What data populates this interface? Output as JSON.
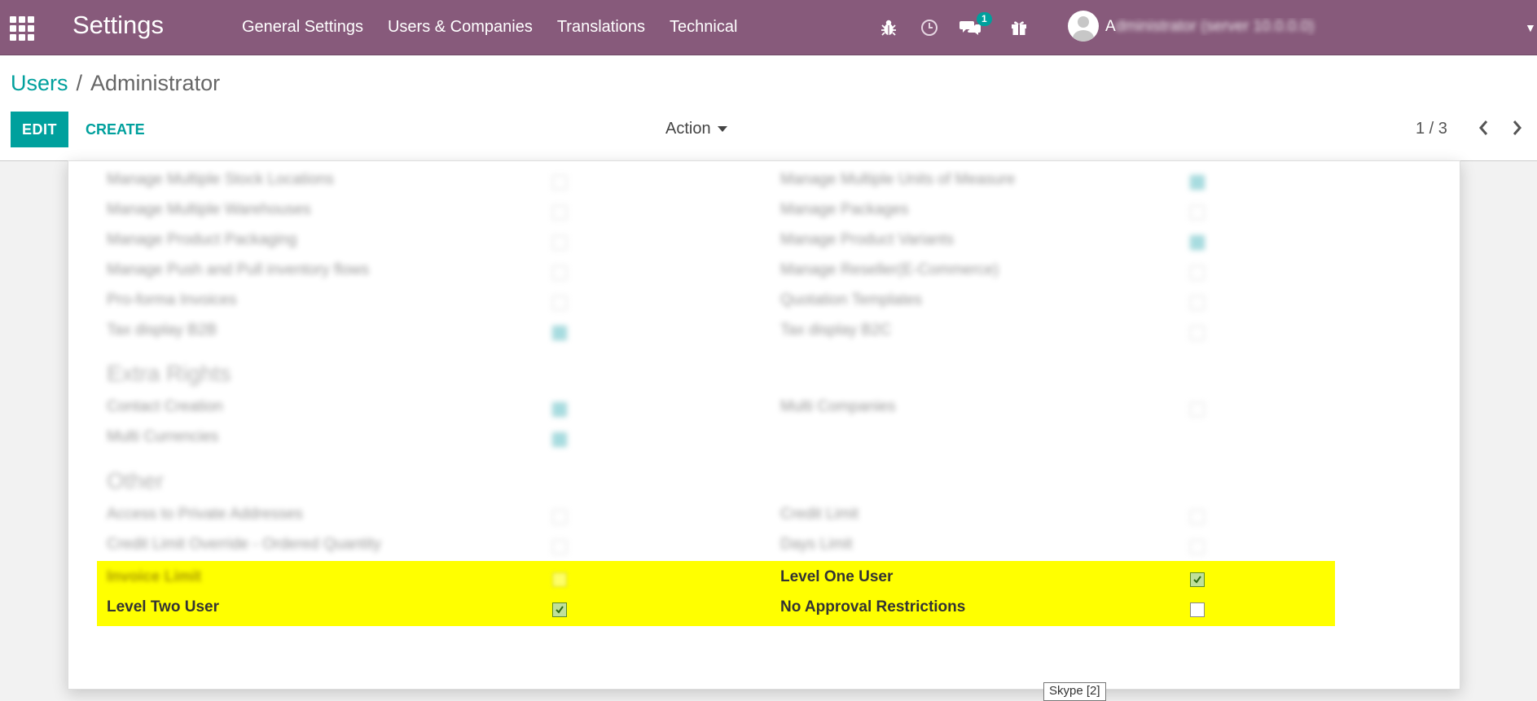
{
  "navbar": {
    "app_title": "Settings",
    "menu": [
      "General Settings",
      "Users & Companies",
      "Translations",
      "Technical"
    ],
    "chat_badge": "1",
    "user_initial": "A",
    "user_rest": "dministrator (server 10.0.0.0)",
    "accent": "#875a7b"
  },
  "breadcrumb": {
    "parent": "Users",
    "separator": "/",
    "current": "Administrator"
  },
  "buttons": {
    "edit": "EDIT",
    "create": "CREATE",
    "action": "Action"
  },
  "pager": {
    "value": "1 / 3"
  },
  "blurred_rights": {
    "rows_left": [
      {
        "label": "Manage Multiple Stock Locations",
        "checked": false
      },
      {
        "label": "Manage Multiple Warehouses",
        "checked": false
      },
      {
        "label": "Manage Product Packaging",
        "checked": false
      },
      {
        "label": "Manage Push and Pull inventory flows",
        "checked": false
      },
      {
        "label": "Pro-forma Invoices",
        "checked": false
      },
      {
        "label": "Tax display B2B",
        "checked": true
      }
    ],
    "rows_right": [
      {
        "label": "Manage Multiple Units of Measure",
        "checked": true
      },
      {
        "label": "Manage Packages",
        "checked": false
      },
      {
        "label": "Manage Product Variants",
        "checked": true
      },
      {
        "label": "Manage Reseller(E-Commerce)",
        "checked": false
      },
      {
        "label": "Quotation Templates",
        "checked": false
      },
      {
        "label": "Tax display B2C",
        "checked": false
      }
    ],
    "extra_title": "Extra Rights",
    "extra_left": [
      {
        "label": "Contact Creation",
        "checked": true
      },
      {
        "label": "Multi Currencies",
        "checked": true
      }
    ],
    "extra_right": [
      {
        "label": "Multi Companies",
        "checked": false
      }
    ],
    "other_title": "Other",
    "other_left": [
      {
        "label": "Access to Private Addresses",
        "checked": false
      },
      {
        "label": "Credit Limit Override - Ordered Quantity",
        "checked": false
      }
    ],
    "other_right": [
      {
        "label": "Credit Limit",
        "checked": false
      },
      {
        "label": "Days Limit",
        "checked": false
      }
    ]
  },
  "highlighted": {
    "invoice_limit": "Invoice Limit",
    "level_one": "Level One User",
    "level_one_checked": true,
    "level_two": "Level Two User",
    "level_two_checked": true,
    "no_approval": "No Approval Restrictions",
    "no_approval_checked": false,
    "highlight_color": "#ffff00"
  },
  "tooltip": "Skype [2]"
}
